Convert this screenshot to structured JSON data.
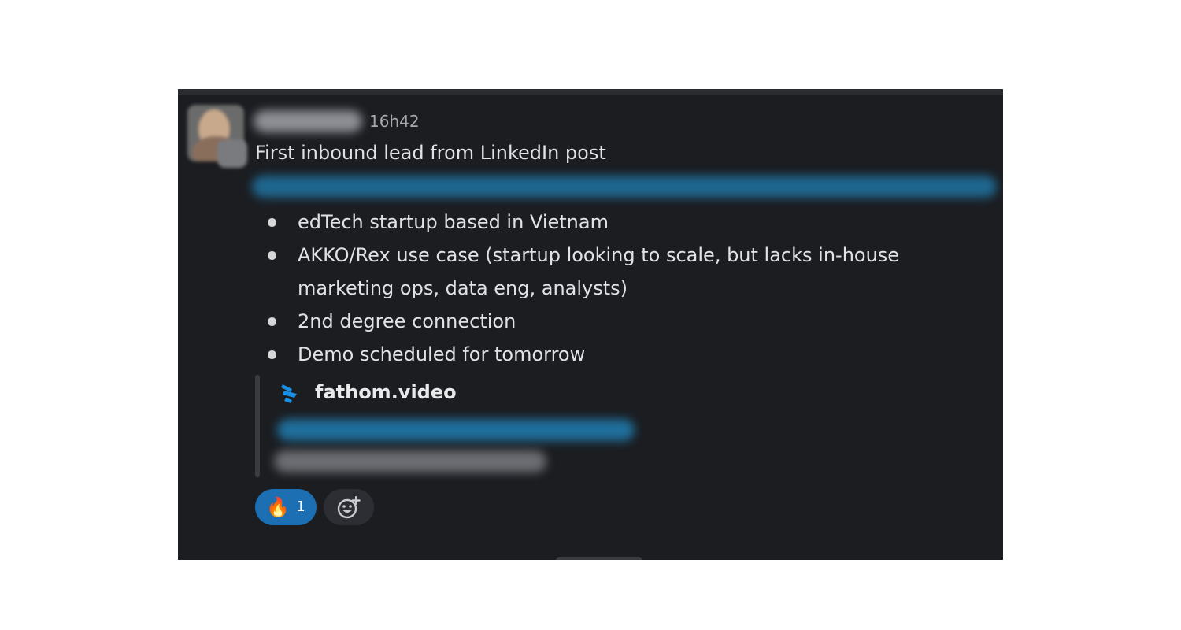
{
  "message": {
    "timestamp": "16h42",
    "title": "First inbound lead from LinkedIn post",
    "bullets": [
      "edTech startup based in Vietnam",
      "AKKO/Rex use case (startup looking to scale, but lacks in-house marketing ops, data eng, analysts)",
      "2nd degree connection",
      "Demo scheduled for tomorrow"
    ]
  },
  "attachment": {
    "site": "fathom.video",
    "icon": "fathom-logo-icon",
    "accent_color": "#1a8fe3"
  },
  "reactions": [
    {
      "emoji": "🔥",
      "count": "1"
    }
  ],
  "add_reaction_icon": "add-emoji-icon",
  "colors": {
    "background": "#1b1d21",
    "text": "#e1e2e4",
    "reaction_active": "#1d6fb3"
  }
}
